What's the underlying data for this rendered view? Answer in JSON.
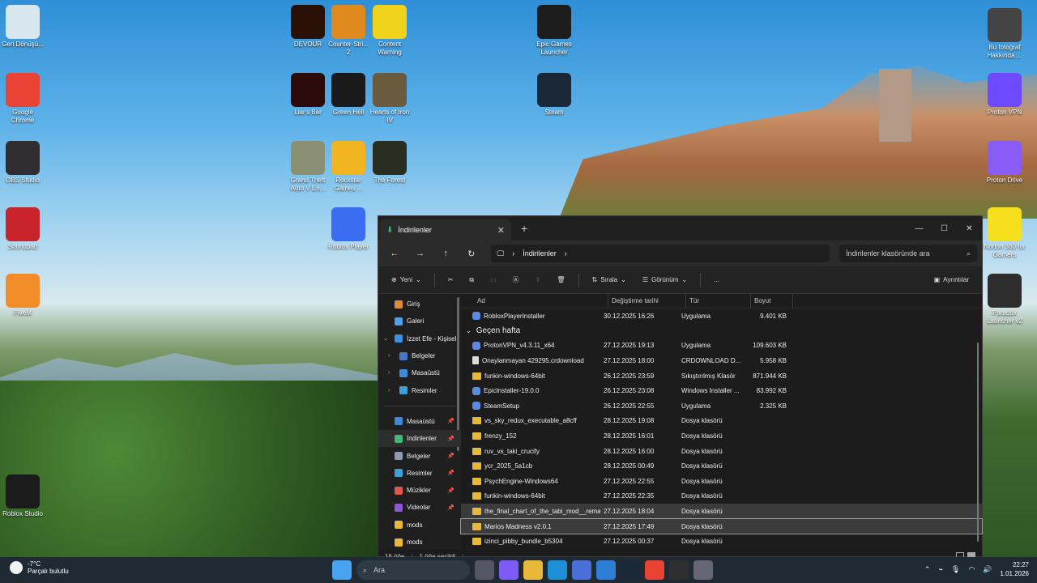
{
  "desktop": {
    "icons": [
      {
        "label": "Geri Dönüşü...",
        "icon": "recycle-bin-icon",
        "color": "#d8e6ef"
      },
      {
        "label": "Google Chrome",
        "icon": "chrome-icon",
        "color": "#e84335"
      },
      {
        "label": "OBS Studio",
        "icon": "obs-icon",
        "color": "#302e31"
      },
      {
        "label": "Soundpad",
        "icon": "soundpad-icon",
        "color": "#c9242b"
      },
      {
        "label": "FiveM",
        "icon": "fivem-icon",
        "color": "#f28c28"
      },
      {
        "label": "Roblox Studio",
        "icon": "roblox-studio-icon",
        "color": "#1b1b1b"
      },
      {
        "label": "DEVOUR",
        "icon": "devour-icon",
        "color": "#2a1108"
      },
      {
        "label": "Counter-Stri... 2",
        "icon": "cs2-icon",
        "color": "#e08a1e"
      },
      {
        "label": "Content Warning",
        "icon": "content-warning-icon",
        "color": "#f1d21b"
      },
      {
        "label": "Liar's Bar",
        "icon": "liars-bar-icon",
        "color": "#2d0a0a"
      },
      {
        "label": "Green Hell",
        "icon": "green-hell-icon",
        "color": "#1a1a1a"
      },
      {
        "label": "Hearts of Iron IV",
        "icon": "hoi4-icon",
        "color": "#6a5b3f"
      },
      {
        "label": "Grand Theft Auto V En...",
        "icon": "gta5-icon",
        "color": "#8a8f72"
      },
      {
        "label": "Rockstar Games ...",
        "icon": "rockstar-icon",
        "color": "#f2b51f"
      },
      {
        "label": "The Forest",
        "icon": "the-forest-icon",
        "color": "#2a2e21"
      },
      {
        "label": "Roblox Player",
        "icon": "roblox-player-icon",
        "color": "#3b6df2"
      },
      {
        "label": "Epic Games Launcher",
        "icon": "epic-games-icon",
        "color": "#1d1d1d"
      },
      {
        "label": "Steam",
        "icon": "steam-icon",
        "color": "#1b2838"
      },
      {
        "label": "Bu fotoğraf Hakkında ...",
        "icon": "photo-info-icon",
        "color": "#444"
      },
      {
        "label": "Proton VPN",
        "icon": "proton-vpn-icon",
        "color": "#6d4aff"
      },
      {
        "label": "Proton Drive",
        "icon": "proton-drive-icon",
        "color": "#8a5cf6"
      },
      {
        "label": "Norton 360 for Gamers",
        "icon": "norton-icon",
        "color": "#f6df1c"
      },
      {
        "label": "Paradox Launcher v2",
        "icon": "paradox-icon",
        "color": "#2d2d2d"
      }
    ]
  },
  "explorer": {
    "tab_title": "İndirilenler",
    "address_crumb": "İndirilenler",
    "search_placeholder": "İndirilenler klasöründe ara",
    "toolbar": {
      "new": "Yeni",
      "sort": "Sırala",
      "view": "Görünüm",
      "more": "...",
      "details": "Ayrıntılar"
    },
    "sidebar": [
      {
        "label": "Giriş",
        "icon": "home-icon",
        "color": "#e08a3c"
      },
      {
        "label": "Galeri",
        "icon": "gallery-icon",
        "color": "#4ea0e8"
      },
      {
        "label": "İzzet Efe - Kişisel",
        "icon": "onedrive-icon",
        "color": "#3b8fe0"
      },
      {
        "label": "Belgeler",
        "icon": "documents-icon",
        "color": "#4a78c8"
      },
      {
        "label": "Masaüstü",
        "icon": "desktop-icon",
        "color": "#3c8ad8"
      },
      {
        "label": "Resimler",
        "icon": "pictures-icon",
        "color": "#3fa0d8"
      },
      {
        "label": "Masaüstü",
        "icon": "desktop-icon",
        "color": "#3c8ad8"
      },
      {
        "label": "İndirilenler",
        "icon": "downloads-icon",
        "color": "#3fb87a"
      },
      {
        "label": "Belgeler",
        "icon": "documents-icon",
        "color": "#8c9bb0"
      },
      {
        "label": "Resimler",
        "icon": "pictures-icon",
        "color": "#3fa0d8"
      },
      {
        "label": "Müzikler",
        "icon": "music-icon",
        "color": "#e0584a"
      },
      {
        "label": "Videolar",
        "icon": "videos-icon",
        "color": "#8d56d6"
      },
      {
        "label": "mods",
        "icon": "folder-icon",
        "color": "#e8b938"
      },
      {
        "label": "mods",
        "icon": "folder-icon",
        "color": "#e8b938"
      }
    ],
    "columns": {
      "name": "Ad",
      "date": "Değiştirme tarihi",
      "type": "Tür",
      "size": "Boyut"
    },
    "top_row": {
      "name": "RobloxPlayerInstaller",
      "date": "30.12.2025 16:26",
      "type": "Uygulama",
      "size": "9.401 KB"
    },
    "group_label": "Geçen hafta",
    "rows": [
      {
        "name": "ProtonVPN_v4.3.11_x64",
        "date": "27.12.2025 19:13",
        "type": "Uygulama",
        "size": "109.603 KB",
        "kind": "app"
      },
      {
        "name": "Onaylanmayan 429295.crdownload",
        "date": "27.12.2025 18:00",
        "type": "CRDOWNLOAD D...",
        "size": "5.958 KB",
        "kind": "file"
      },
      {
        "name": "funkin-windows-64bit",
        "date": "26.12.2025 23:59",
        "type": "Sıkıştırılmış Klasör",
        "size": "871.944 KB",
        "kind": "folder"
      },
      {
        "name": "EpicInstaller-19.0.0",
        "date": "26.12.2025 23:08",
        "type": "Windows Installer ...",
        "size": "83.992 KB",
        "kind": "app"
      },
      {
        "name": "SteamSetup",
        "date": "26.12.2025 22:55",
        "type": "Uygulama",
        "size": "2.325 KB",
        "kind": "app"
      },
      {
        "name": "vs_sky_redux_executable_a8cff",
        "date": "28.12.2025 19:08",
        "type": "Dosya klasörü",
        "size": "",
        "kind": "folder"
      },
      {
        "name": "frenzy_152",
        "date": "28.12.2025 16:01",
        "type": "Dosya klasörü",
        "size": "",
        "kind": "folder"
      },
      {
        "name": "ruv_vs_taki_crucify",
        "date": "28.12.2025 16:00",
        "type": "Dosya klasörü",
        "size": "",
        "kind": "folder"
      },
      {
        "name": "ycr_2025_5a1cb",
        "date": "28.12.2025 00:49",
        "type": "Dosya klasörü",
        "size": "",
        "kind": "folder"
      },
      {
        "name": "PsychEngine-Windows64",
        "date": "27.12.2025 22:55",
        "type": "Dosya klasörü",
        "size": "",
        "kind": "folder"
      },
      {
        "name": "funkin-windows-64bit",
        "date": "27.12.2025 22:35",
        "type": "Dosya klasörü",
        "size": "",
        "kind": "folder"
      },
      {
        "name": "the_final_chart_of_the_tabi_mod__remast...",
        "date": "27.12.2025 18:04",
        "type": "Dosya klasörü",
        "size": "",
        "kind": "folder",
        "state": "hover"
      },
      {
        "name": "Marios Madness v2.0.1",
        "date": "27.12.2025 17:49",
        "type": "Dosya klasörü",
        "size": "",
        "kind": "folder",
        "state": "selected"
      },
      {
        "name": "izinci_pibby_bundle_b5304",
        "date": "27.12.2025 00:37",
        "type": "Dosya klasörü",
        "size": "",
        "kind": "folder"
      }
    ],
    "status": {
      "count": "16 öğe",
      "selected": "1 öğe seçildi"
    }
  },
  "taskbar": {
    "weather_temp": "-7°C",
    "weather_desc": "Parçalı bulutlu",
    "search_label": "Ara",
    "apps": [
      "start-icon",
      "task-view-icon",
      "copilot-icon",
      "file-explorer-icon",
      "edge-icon",
      "store-icon",
      "mail-icon",
      "steam-icon",
      "chrome-icon",
      "obs-icon",
      "settings-icon"
    ],
    "time": "22:27",
    "date": "1.01.2026"
  }
}
